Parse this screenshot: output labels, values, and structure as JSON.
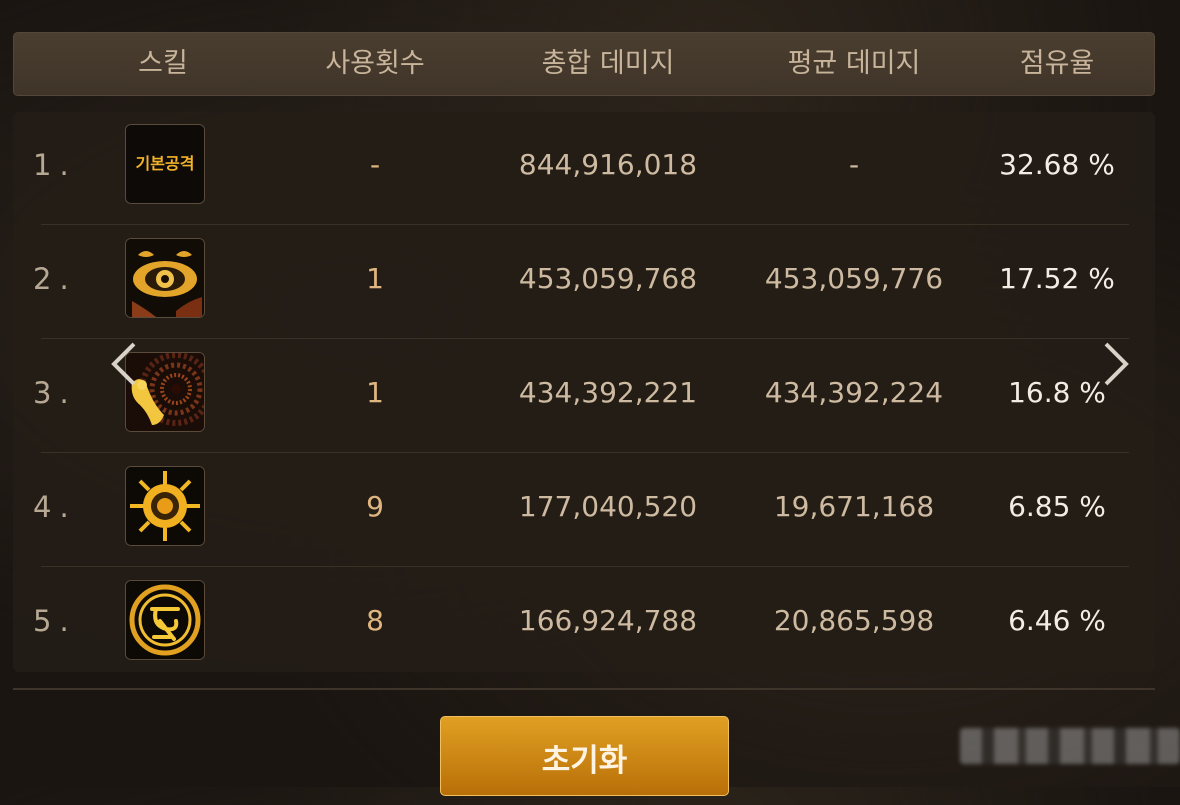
{
  "header": {
    "skill": "스킬",
    "uses": "사용횟수",
    "total_damage": "총합 데미지",
    "avg_damage": "평균 데미지",
    "share": "점유율"
  },
  "rows": [
    {
      "rank": "1.",
      "icon": "basic-attack-icon",
      "icon_label": "기본공격",
      "uses": "-",
      "total": "844,916,018",
      "avg": "-",
      "share": "32.68 %"
    },
    {
      "rank": "2.",
      "icon": "eye-skill-icon",
      "uses": "1",
      "total": "453,059,768",
      "avg": "453,059,776",
      "share": "17.52 %"
    },
    {
      "rank": "3.",
      "icon": "vortex-figure-skill-icon",
      "uses": "1",
      "total": "434,392,221",
      "avg": "434,392,224",
      "share": "16.8 %"
    },
    {
      "rank": "4.",
      "icon": "sun-burst-skill-icon",
      "uses": "9",
      "total": "177,040,520",
      "avg": "19,671,168",
      "share": "6.85 %"
    },
    {
      "rank": "5.",
      "icon": "rune-circle-skill-icon",
      "uses": "8",
      "total": "166,924,788",
      "avg": "20,865,598",
      "share": "6.46 %"
    }
  ],
  "reset_button": "초기화",
  "nav": {
    "prev_icon": "chevron-left-icon",
    "next_icon": "chevron-right-icon"
  },
  "colors": {
    "accent": "#d88f14",
    "header_bg": "#463a2d",
    "text_gold": "#e0b680",
    "text_light": "#f1ece4"
  }
}
